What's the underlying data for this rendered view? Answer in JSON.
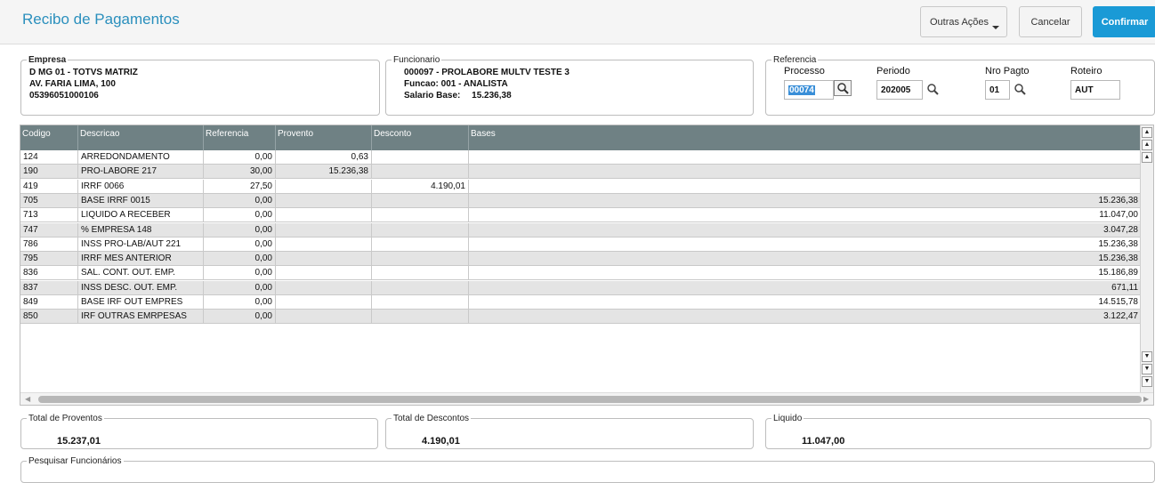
{
  "header": {
    "title": "Recibo de Pagamentos",
    "outras_acoes": "Outras Ações",
    "cancelar": "Cancelar",
    "confirmar": "Confirmar"
  },
  "empresa": {
    "legend": "Empresa",
    "line1": "D MG 01  - TOTVS MATRIZ",
    "line2": "AV. FARIA LIMA, 100",
    "line3": "05396051000106"
  },
  "funcionario": {
    "legend": "Funcionario",
    "line1": "000097 - PROLABORE MULTV TESTE 3",
    "line2": "Funcao: 001   - ANALISTA",
    "line3_label": "Salario Base:",
    "line3_value": "15.236,38"
  },
  "referencia": {
    "legend": "Referencia",
    "processo_label": "Processo",
    "processo_value": "00074",
    "periodo_label": "Periodo",
    "periodo_value": "202005",
    "nro_pagto_label": "Nro Pagto",
    "nro_pagto_value": "01",
    "roteiro_label": "Roteiro",
    "roteiro_value": "AUT"
  },
  "grid": {
    "columns": [
      "Codigo",
      "Descricao",
      "Referencia",
      "Provento",
      "Desconto",
      "Bases"
    ],
    "rows": [
      [
        "124",
        "ARREDONDAMENTO",
        "0,00",
        "0,63",
        "",
        ""
      ],
      [
        "190",
        "PRO-LABORE 217",
        "30,00",
        "15.236,38",
        "",
        ""
      ],
      [
        "419",
        "IRRF 0066",
        "27,50",
        "",
        "4.190,01",
        ""
      ],
      [
        "705",
        "BASE IRRF 0015",
        "0,00",
        "",
        "",
        "15.236,38"
      ],
      [
        "713",
        "LIQUIDO A RECEBER",
        "0,00",
        "",
        "",
        "11.047,00"
      ],
      [
        "747",
        "% EMPRESA  148",
        "0,00",
        "",
        "",
        "3.047,28"
      ],
      [
        "786",
        "INSS PRO-LAB/AUT 221",
        "0,00",
        "",
        "",
        "15.236,38"
      ],
      [
        "795",
        "IRRF MES ANTERIOR",
        "0,00",
        "",
        "",
        "15.236,38"
      ],
      [
        "836",
        "SAL. CONT. OUT. EMP.",
        "0,00",
        "",
        "",
        "15.186,89"
      ],
      [
        "837",
        "INSS DESC. OUT. EMP.",
        "0,00",
        "",
        "",
        "671,11"
      ],
      [
        "849",
        "BASE IRF OUT EMPRES",
        "0,00",
        "",
        "",
        "14.515,78"
      ],
      [
        "850",
        "IRF OUTRAS EMRPESAS",
        "0,00",
        "",
        "",
        "3.122,47"
      ]
    ]
  },
  "totals": {
    "proventos_label": "Total de Proventos",
    "proventos_value": "15.237,01",
    "descontos_label": "Total de Descontos",
    "descontos_value": "4.190,01",
    "liquido_label": "Liquido",
    "liquido_value": "11.047,00"
  },
  "pesquisar": {
    "legend": "Pesquisar Funcionários"
  }
}
